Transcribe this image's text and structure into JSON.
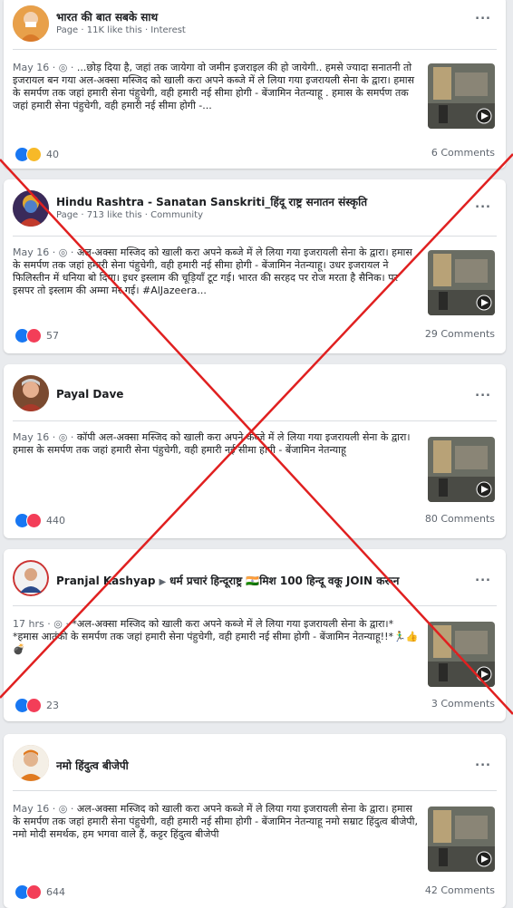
{
  "posts": [
    {
      "author": "भारत की बात सबके साथ",
      "group": "",
      "subtitle": "Page · 11K like this · Interest",
      "date": "May 16 · ",
      "text": "...छोड़ दिया है, जहां तक जायेगा वो जमीन इजराइल की हो जायेगी.. हमसे ज्यादा सनातनी तो इजरायल बन गया अल-अक्सा मस्जिद को खाली करा अपने कब्जे में ले लिया गया इजरायली सेना के द्वारा। हमास के समर्पण तक जहां हमारी सेना पंहुचेगी, वही हमारी नई सीमा होगी - बेंजामिन नेतन्याहू . हमास के समर्पण तक जहां हमारी सेना पंहुचेगी, वही हमारी नई सीमा होगी -...",
      "reactions": "40",
      "comments": "6 Comments"
    },
    {
      "author": "Hindu Rashtra - Sanatan Sanskriti_हिंदू राष्ट्र सनातन संस्कृति",
      "group": "",
      "subtitle": "Page · 713 like this · Community",
      "date": "May 16 · ",
      "text": "अल-अक्सा मस्जिद को खाली करा अपने कब्जे में ले लिया गया इजरायली सेना के द्वारा। हमास के समर्पण तक जहां हमारी सेना पंहुचेगी, वही हमारी नई सीमा होगी - बेंजामिन नेतन्याहू। उधर इजरायल ने फिलिस्तीन में धनिया बो दिया। इधर इस्लाम की चूड़ियाँ टूट गई। भारत की सरहद पर रोज मरता है सैनिक। पर इसपर तो इस्लाम की अम्मा मर गई। #AlJazeera...",
      "reactions": "57",
      "comments": "29 Comments"
    },
    {
      "author": "Payal Dave",
      "group": "",
      "subtitle": "",
      "date": "May 16 · ",
      "text": "कॉपी अल-अक्सा मस्जिद को खाली करा अपने कब्जे में ले लिया गया इजरायली सेना के द्वारा। हमास के समर्पण तक जहां हमारी सेना पंहुचेगी, वही हमारी नई सीमा होगी - बेंजामिन नेतन्याहू",
      "reactions": "440",
      "comments": "80 Comments"
    },
    {
      "author": "Pranjal Kashyap",
      "group": "धर्म प्रचारं हिन्दूराष्ट्र 🇮🇳मिश 100 हिन्दू वकू JOIN करून",
      "subtitle": "",
      "date": "17 hrs · ",
      "text": "*अल-अक्सा मस्जिद को खाली करा अपने कब्जे में ले लिया गया इजरायली सेना के द्वारा।* *हमास आतंकी के समर्पण तक जहां हमारी सेना पंहुचेगी, वही हमारी नई सीमा होगी - बेंजामिन नेतन्याहू!!*🏃‍♂️👍💣",
      "reactions": "23",
      "comments": "3 Comments"
    },
    {
      "author": "नमो हिंदुत्व बीजेपी",
      "group": "",
      "subtitle": "",
      "date": "May 16 · ",
      "text": "अल-अक्सा मस्जिद को खाली करा अपने कब्जे में ले लिया गया इजरायली सेना के द्वारा। हमास के समर्पण तक जहां हमारी सेना पंहुचेगी, वही हमारी नई सीमा होगी - बेंजामिन नेतन्याहू नमो सम्राट हिंदुत्व बीजेपी, नमो मोदी समर्थक, हम भगवा वाले हैं, कट्टर हिंदुत्व बीजेपी",
      "reactions": "644",
      "comments": "42 Comments"
    }
  ],
  "ui": {
    "more_label": "...",
    "arrow": "▶"
  },
  "colors": {
    "like": "#1877f2",
    "love": "#f33e58",
    "wow": "#f7b928",
    "cross": "#e02020"
  }
}
